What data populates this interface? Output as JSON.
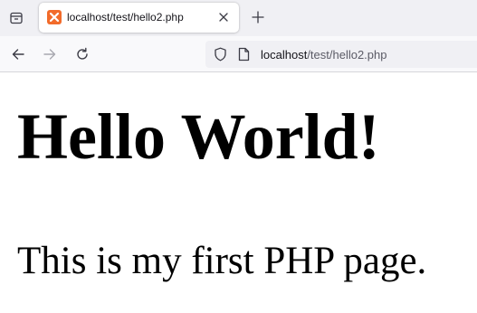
{
  "tab": {
    "title": "localhost/test/hello2.php",
    "favicon": "xampp-icon"
  },
  "toolbar": {
    "tab_list_icon": "tab-list-icon",
    "close_tab_icon": "close-icon",
    "new_tab_icon": "plus-icon",
    "back_icon": "back-arrow-icon",
    "forward_icon": "forward-arrow-icon",
    "reload_icon": "reload-icon"
  },
  "urlbar": {
    "host": "localhost",
    "path": "/test/hello2.php",
    "shield_icon": "shield-icon",
    "page_icon": "page-icon"
  },
  "page": {
    "heading": "Hello World!",
    "paragraph": "This is my first PHP page."
  },
  "colors": {
    "favicon": "#f26b2a",
    "tabstrip_bg": "#f0f0f4",
    "navbar_bg": "#f9f9fb",
    "urlbar_bg": "#f0f0f4"
  }
}
